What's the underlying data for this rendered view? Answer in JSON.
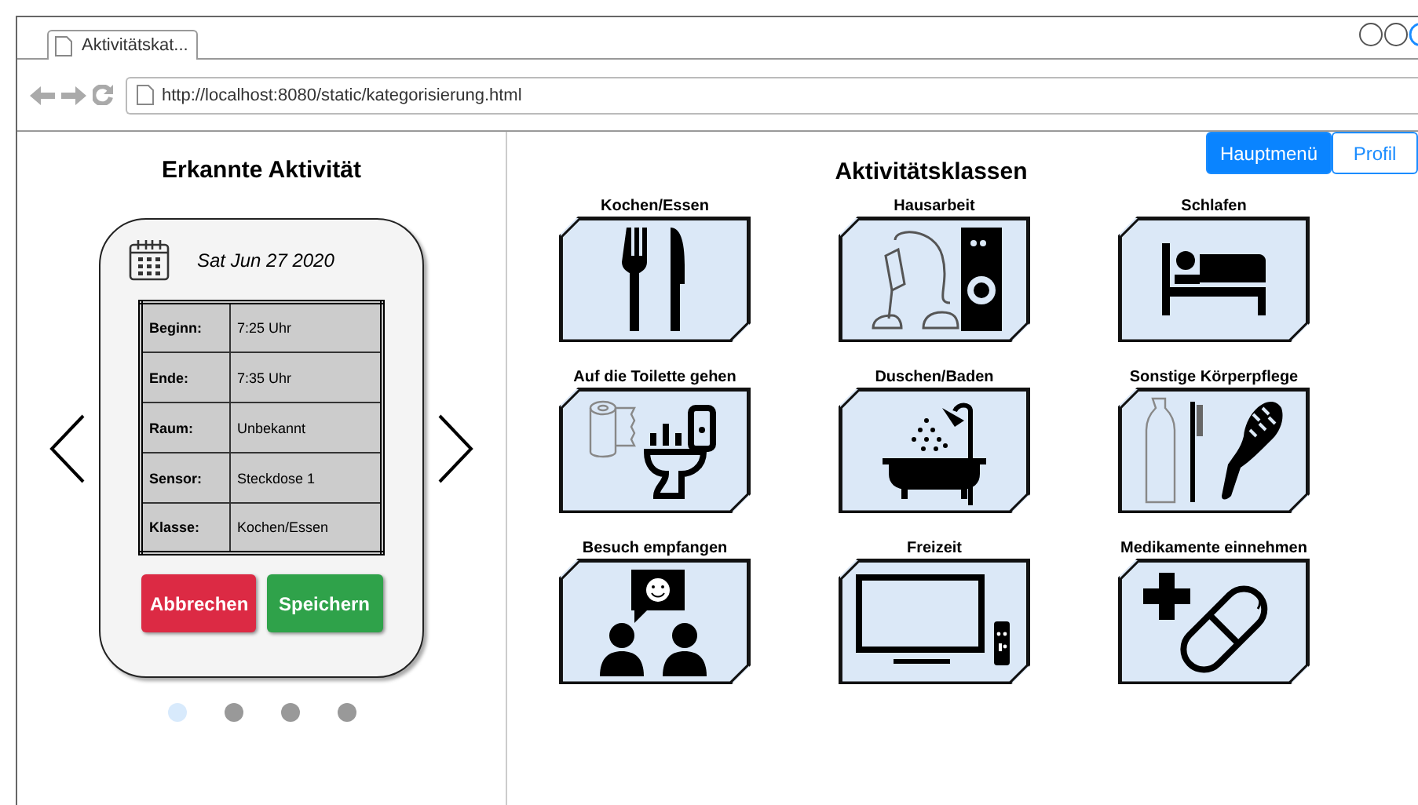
{
  "browser": {
    "tab_title": "Aktivitätskat...",
    "url": "http://localhost:8080/static/kategorisierung.html"
  },
  "nav_buttons": [
    {
      "label": "Hauptmenü",
      "selected": true
    },
    {
      "label": "Profil",
      "selected": false
    }
  ],
  "detected_activity": {
    "title": "Erkannte Aktivität",
    "date": "Sat Jun 27 2020",
    "rows": [
      {
        "label": "Beginn:",
        "value": "7:25 Uhr"
      },
      {
        "label": "Ende:",
        "value": "7:35 Uhr"
      },
      {
        "label": "Raum:",
        "value": "Unbekannt"
      },
      {
        "label": "Sensor:",
        "value": "Steckdose 1"
      },
      {
        "label": "Klasse:",
        "value": "Kochen/Essen"
      }
    ],
    "cancel_button": "Abbrechen",
    "save_button": "Speichern",
    "pages": [
      {
        "selected": true
      },
      {
        "selected": false
      },
      {
        "selected": false
      },
      {
        "selected": false
      }
    ]
  },
  "activity_classes": {
    "title": "Aktivitätsklassen",
    "items": [
      {
        "label": "Kochen/Essen",
        "kind": "cutlery"
      },
      {
        "label": "Hausarbeit",
        "kind": "housework"
      },
      {
        "label": "Schlafen",
        "kind": "bed"
      },
      {
        "label": "Auf die Toilette gehen",
        "kind": "toilet"
      },
      {
        "label": "Duschen/Baden",
        "kind": "bath"
      },
      {
        "label": "Sonstige Körperpflege",
        "kind": "care"
      },
      {
        "label": "Besuch empfangen",
        "kind": "visitors"
      },
      {
        "label": "Freizeit",
        "kind": "tv"
      },
      {
        "label": "Medikamente einnehmen",
        "kind": "medicine"
      }
    ]
  }
}
